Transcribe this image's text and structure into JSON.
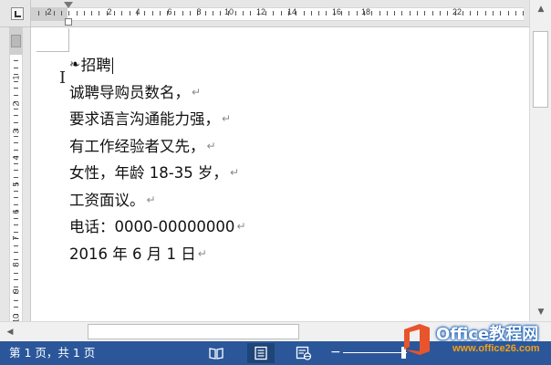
{
  "document": {
    "lines": [
      "招聘",
      "诚聘导购员数名，",
      "要求语言沟通能力强，",
      "有工作经验者又先，",
      "女性，年龄 18-35 岁，",
      "工资面议。",
      "电话：0000-00000000",
      "2016 年 6 月 1 日"
    ],
    "bullet": "❧",
    "paragraph_mark": "↵"
  },
  "ruler": {
    "h_numbers": [
      "2",
      "2",
      "4",
      "6",
      "8",
      "10",
      "12",
      "14",
      "16",
      "18",
      "22"
    ],
    "v_numbers": [
      "1",
      "2",
      "3",
      "4",
      "5",
      "6",
      "7",
      "8",
      "9",
      "10"
    ]
  },
  "status_bar": {
    "page_info": "第 1 页，共 1 页",
    "zoom_minus": "−"
  },
  "watermark": {
    "title": "Office教程网",
    "url": "www.office26.com"
  },
  "colors": {
    "status_bar": "#2b579a",
    "watermark_logo": "#e8542b",
    "watermark_url": "#f4a01a"
  },
  "icons": {
    "read_mode": "book-icon",
    "print_layout": "page-icon",
    "web_layout": "web-page-icon"
  }
}
